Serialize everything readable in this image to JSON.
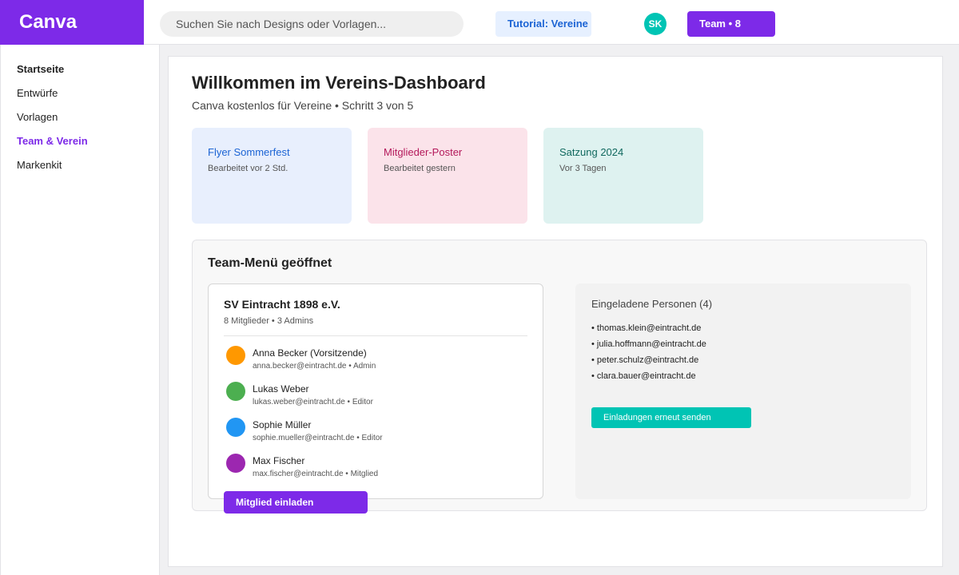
{
  "header": {
    "logo": "Canva",
    "search_placeholder": "Suchen Sie nach Designs oder Vorlagen...",
    "tutorial_label": "Tutorial: Vereine",
    "user_initials": "SK",
    "team_button_label": "Team • 8"
  },
  "sidebar": {
    "items": [
      {
        "label": "Startseite"
      },
      {
        "label": "Entwürfe"
      },
      {
        "label": "Vorlagen"
      },
      {
        "label": "Team & Verein"
      },
      {
        "label": "Markenkit"
      }
    ]
  },
  "main": {
    "title": "Willkommen im Vereins-Dashboard",
    "subtitle": "Canva kostenlos für Vereine • Schritt 3 von 5",
    "cards": [
      {
        "title": "Flyer Sommerfest",
        "meta": "Bearbeitet vor 2 Std."
      },
      {
        "title": "Mitglieder-Poster",
        "meta": "Bearbeitet gestern"
      },
      {
        "title": "Satzung 2024",
        "meta": "Vor 3 Tagen"
      }
    ]
  },
  "team_menu": {
    "title": "Team-Menü geöffnet",
    "team_name": "SV Eintracht 1898 e.V.",
    "team_count": "8 Mitglieder • 3 Admins",
    "members": [
      {
        "name": "Anna Becker (Vorsitzende)",
        "detail": "anna.becker@eintracht.de • Admin"
      },
      {
        "name": "Lukas Weber",
        "detail": "lukas.weber@eintracht.de • Editor"
      },
      {
        "name": "Sophie Müller",
        "detail": "sophie.mueller@eintracht.de • Editor"
      },
      {
        "name": "Max Fischer",
        "detail": "max.fischer@eintracht.de • Mitglied"
      }
    ],
    "invite_button": "Mitglied einladen",
    "invited": {
      "title": "Eingeladene Personen (4)",
      "emails": [
        "• thomas.klein@eintracht.de",
        "• julia.hoffmann@eintracht.de",
        "• peter.schulz@eintracht.de",
        "• clara.bauer@eintracht.de"
      ],
      "resend_button": "Einladungen erneut senden"
    }
  },
  "colors": {
    "brand": "#7d2ae8",
    "teal": "#00c4b4",
    "card_blue_bg": "#e8effd",
    "card_blue_text": "#1c64d4",
    "card_pink_bg": "#fbe3ea",
    "card_pink_text": "#b4195b",
    "card_teal_bg": "#def2f0",
    "card_teal_text": "#11695f",
    "avatar_orange": "#ff9800",
    "avatar_green": "#4caf50",
    "avatar_blue": "#2196f3",
    "avatar_purple": "#9c27b0"
  }
}
